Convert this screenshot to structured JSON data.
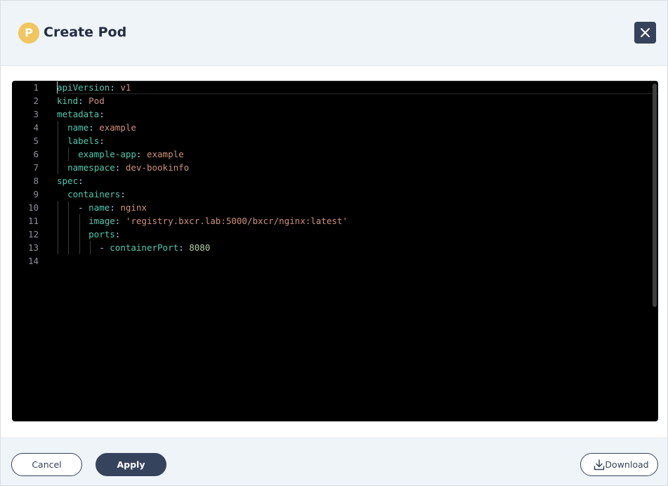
{
  "header": {
    "icon_letter": "P",
    "title": "Create Pod"
  },
  "editor": {
    "lines": [
      {
        "n": "1",
        "tokens": [
          {
            "t": "apiVersion",
            "c": "k"
          },
          {
            "t": ": ",
            "c": "p"
          },
          {
            "t": "v1",
            "c": "v"
          }
        ]
      },
      {
        "n": "2",
        "tokens": [
          {
            "t": "kind",
            "c": "k"
          },
          {
            "t": ": ",
            "c": "p"
          },
          {
            "t": "Pod",
            "c": "v"
          }
        ]
      },
      {
        "n": "3",
        "tokens": [
          {
            "t": "metadata",
            "c": "k"
          },
          {
            "t": ":",
            "c": "p"
          }
        ]
      },
      {
        "n": "4",
        "tokens": [
          {
            "t": "  "
          },
          {
            "t": "name",
            "c": "k"
          },
          {
            "t": ": ",
            "c": "p"
          },
          {
            "t": "example",
            "c": "v"
          }
        ]
      },
      {
        "n": "5",
        "tokens": [
          {
            "t": "  "
          },
          {
            "t": "labels",
            "c": "k"
          },
          {
            "t": ":",
            "c": "p"
          }
        ]
      },
      {
        "n": "6",
        "tokens": [
          {
            "t": "    "
          },
          {
            "t": "example-app",
            "c": "k"
          },
          {
            "t": ": ",
            "c": "p"
          },
          {
            "t": "example",
            "c": "v"
          }
        ]
      },
      {
        "n": "7",
        "tokens": [
          {
            "t": "  "
          },
          {
            "t": "namespace",
            "c": "k"
          },
          {
            "t": ": ",
            "c": "p"
          },
          {
            "t": "dev-bookinfo",
            "c": "v"
          }
        ]
      },
      {
        "n": "8",
        "tokens": [
          {
            "t": "spec",
            "c": "k"
          },
          {
            "t": ":",
            "c": "p"
          }
        ]
      },
      {
        "n": "9",
        "tokens": [
          {
            "t": "  "
          },
          {
            "t": "containers",
            "c": "k"
          },
          {
            "t": ":",
            "c": "p"
          }
        ]
      },
      {
        "n": "10",
        "tokens": [
          {
            "t": "    "
          },
          {
            "t": "- ",
            "c": "p"
          },
          {
            "t": "name",
            "c": "k"
          },
          {
            "t": ": ",
            "c": "p"
          },
          {
            "t": "nginx",
            "c": "v"
          }
        ]
      },
      {
        "n": "11",
        "tokens": [
          {
            "t": "      "
          },
          {
            "t": "image",
            "c": "k"
          },
          {
            "t": ": ",
            "c": "p"
          },
          {
            "t": "'registry.bxcr.lab:5000/bxcr/nginx:latest'",
            "c": "v"
          }
        ]
      },
      {
        "n": "12",
        "tokens": [
          {
            "t": "      "
          },
          {
            "t": "ports",
            "c": "k"
          },
          {
            "t": ":",
            "c": "p"
          }
        ]
      },
      {
        "n": "13",
        "tokens": [
          {
            "t": "        "
          },
          {
            "t": "- ",
            "c": "p"
          },
          {
            "t": "containerPort",
            "c": "k"
          },
          {
            "t": ": ",
            "c": "p"
          },
          {
            "t": "8080",
            "c": "n"
          }
        ]
      },
      {
        "n": "14",
        "tokens": []
      }
    ]
  },
  "footer": {
    "cancel_label": "Cancel",
    "apply_label": "Apply",
    "download_label": "Download"
  },
  "colors": {
    "primary": "#36435c",
    "icon_badge": "#f1c65f",
    "header_bg": "#eff4f9",
    "editor_bg": "#000000"
  }
}
